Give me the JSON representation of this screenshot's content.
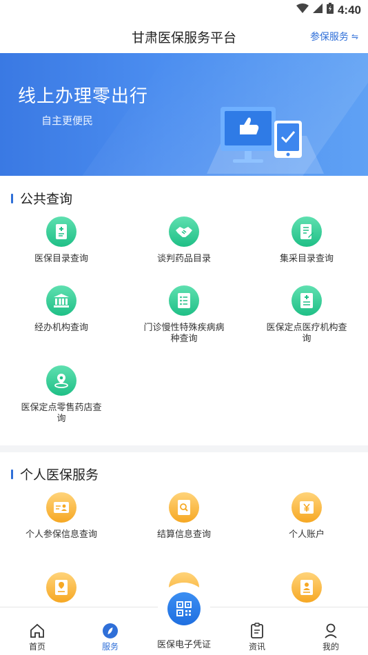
{
  "status_bar": {
    "time": "4:40"
  },
  "header": {
    "title": "甘肃医保服务平台",
    "action_label": "参保服务",
    "action_icon": "swap-icon"
  },
  "banner": {
    "title": "线上办理零出行",
    "subtitle": "自主更便民"
  },
  "public_query": {
    "title": "公共查询",
    "items": [
      {
        "label": "医保目录查询",
        "icon": "document-plus-icon"
      },
      {
        "label": "谈判药品目录",
        "icon": "handshake-icon"
      },
      {
        "label": "集采目录查询",
        "icon": "document-edit-icon"
      },
      {
        "label": "经办机构查询",
        "icon": "institution-icon"
      },
      {
        "label": "门诊慢性特殊疾病病种查询",
        "icon": "list-icon"
      },
      {
        "label": "医保定点医疗机构查询",
        "icon": "medical-doc-icon"
      },
      {
        "label": "医保定点零售药店查询",
        "icon": "location-icon"
      }
    ]
  },
  "personal_service": {
    "title": "个人医保服务",
    "items": [
      {
        "label": "个人参保信息查询",
        "icon": "id-card-icon"
      },
      {
        "label": "结算信息查询",
        "icon": "search-doc-icon"
      },
      {
        "label": "个人账户",
        "icon": "yen-account-icon"
      },
      {
        "label": "",
        "icon": "location-card-icon"
      },
      {
        "label": "",
        "icon": "orange-icon"
      },
      {
        "label": "",
        "icon": "person-doc-icon"
      }
    ]
  },
  "bottom_nav": {
    "home": "首页",
    "service": "服务",
    "credential": "医保电子凭证",
    "news": "资讯",
    "mine": "我的"
  },
  "colors": {
    "accent": "#2f6fd8",
    "green": "#1fbf86",
    "orange": "#f6a823"
  }
}
